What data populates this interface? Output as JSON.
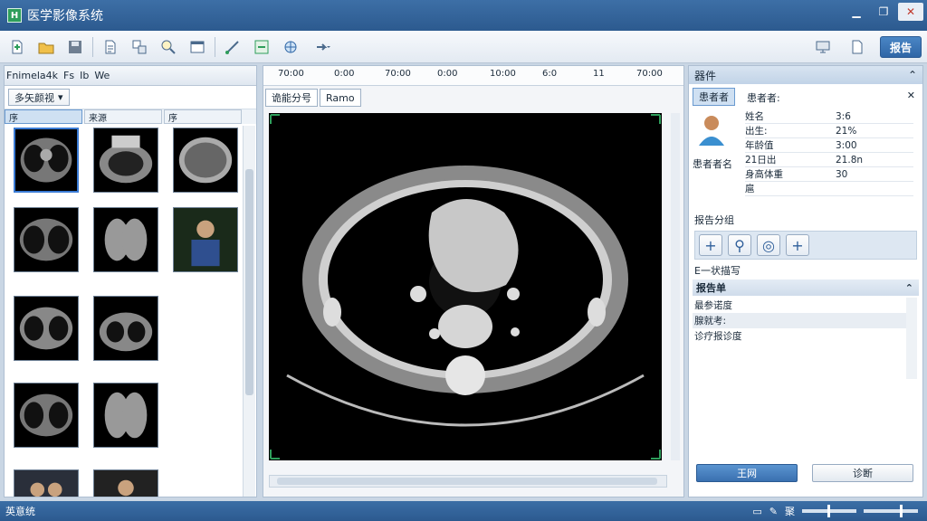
{
  "app": {
    "title": "医学影像系统",
    "icon_text": "H"
  },
  "window": {
    "min": "▁",
    "max": "❐",
    "close": "✕"
  },
  "toolbar": {
    "report_label": "报告"
  },
  "left": {
    "tabs": [
      "Fnimela4k",
      "Fs",
      "Ib",
      "We"
    ],
    "filter_label": "多矢颜视",
    "col_heads": [
      "序",
      "来源",
      "序"
    ]
  },
  "ruler": {
    "labels": [
      "70:00",
      "0:00",
      "70:00",
      "0:00",
      "10:00",
      "6:0",
      "11",
      "70:00"
    ]
  },
  "viewer": {
    "tabs": [
      "诡能分号",
      "Ramo"
    ]
  },
  "right": {
    "header": "器件",
    "patient_tab": "患者者",
    "patient_title": "患者者:",
    "patient_label": "患者者名",
    "rows": [
      {
        "k": "姓名",
        "v": "3:6"
      },
      {
        "k": "出生:",
        "v": "21%"
      },
      {
        "k": "年龄值",
        "v": "3:00"
      },
      {
        "k": "21日出",
        "v": "21.8n"
      },
      {
        "k": "身高体重",
        "v": "30"
      }
    ],
    "extra": "扈",
    "tools_label": "报告分组",
    "note_label": "E一状描写",
    "list_head": "报告单",
    "list_items": [
      "最参诺度",
      "腺就考:",
      "诊疗报诊度"
    ],
    "primary_btn": "王网",
    "secondary_btn": "诊断"
  },
  "status": {
    "left": "英意统",
    "zoom_label": "聚"
  }
}
